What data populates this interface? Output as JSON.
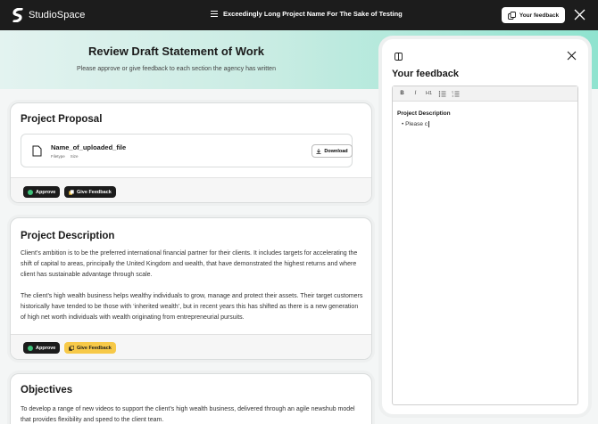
{
  "app": {
    "brand": "StudioSpace",
    "project_title": "Exceedingly Long Project Name For The Sake of Testing",
    "feedback_button": "Your feedback"
  },
  "hero": {
    "title": "Review Draft Statement of Work",
    "subtitle": "Please approve or give feedback to each section the agency has written"
  },
  "sections": [
    {
      "title": "Project Proposal",
      "file": {
        "name": "Name_of_uploaded_file",
        "type_label": "Filetype",
        "size_label": "Size",
        "download_label": "Download"
      },
      "approve_label": "Approve",
      "feedback_label": "Give Feedback"
    },
    {
      "title": "Project Description",
      "paragraphs": [
        "Client’s ambition is to be the preferred international financial partner for their clients. It includes targets for accelerating the shift of capital to areas, principally the United Kingdom and wealth, that have demonstrated the highest returns and where client has sustainable advantage through scale.",
        "The client’s high wealth business helps wealthy individuals to grow, manage and protect their assets. Their target customers historically have tended to be those with ‘inherited wealth’, but in recent years this has shifted as there is a new generation of high net worth individuals with wealth originating from entrepreneurial pursuits."
      ],
      "approve_label": "Approve",
      "feedback_label": "Give Feedback"
    },
    {
      "title": "Objectives",
      "paragraphs": [
        "To develop a range of new videos to support the client’s high wealth business, delivered through an agile newshub model that provides flexibility and speed to the client team."
      ]
    }
  ],
  "panel": {
    "title": "Your feedback",
    "toolbar": [
      "B",
      "I",
      "H1",
      "bulleted-list",
      "numbered-list"
    ],
    "editor_heading": "Project Description",
    "editor_bullet": "Please c"
  },
  "colors": {
    "topbar": "#1c1c1c",
    "accent_green": "#3ec27a",
    "feedback_active": "#f7c948",
    "hero_gradient_end": "#8fe3cf"
  }
}
